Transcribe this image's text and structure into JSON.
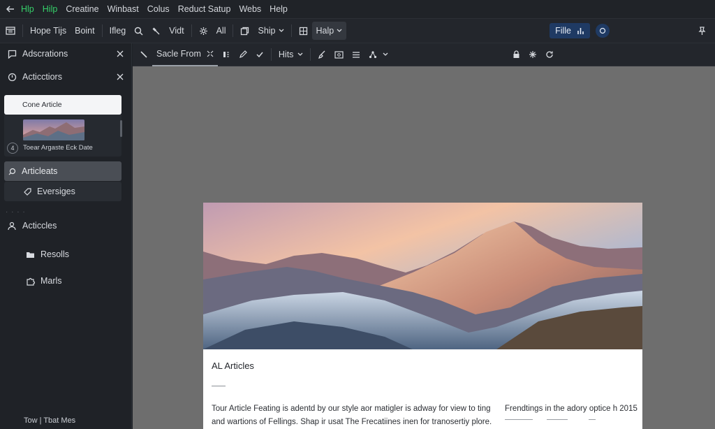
{
  "menubar": {
    "items": [
      "Hlp",
      "Hilp",
      "Creatine",
      "Winbast",
      "Colus",
      "Reduct Satup",
      "Webs",
      "Help"
    ]
  },
  "toolbar": {
    "items": [
      "Hope Tijs",
      "Boint",
      "Ifleg",
      "Vidt",
      "All",
      "Ship",
      "Halp"
    ],
    "file_label": "Fille"
  },
  "sidebar": {
    "annotations": "Adscrations",
    "actictions": "Acticctiors",
    "doc_card": "Cone Article",
    "thumb_caption": "Toear Argaste Eck Date",
    "thumb_num": "4",
    "selected": "Articleats",
    "sub": "Eversiges",
    "articles": "Acticcles",
    "resolls": "Resolls",
    "marls": "Marls",
    "footer": "Tow | Tbat Mes"
  },
  "toolbar2": {
    "source_from": "Sacle From",
    "hits": "Hits"
  },
  "article": {
    "title": "AL Articles",
    "line1": "Tour Article Feating is adentd by our style aor matigler is adway for view to ting",
    "line2": "and wartions of Fellings.  Shap ir usat The Frecatiines inen for tranosertiy plore.",
    "side": "Frendtings in the adory optice h 2015"
  },
  "colors": {
    "accent_green": "#36d06a",
    "file_button_bg": "#1f3a63",
    "canvas_bg": "#6e6e6e"
  }
}
